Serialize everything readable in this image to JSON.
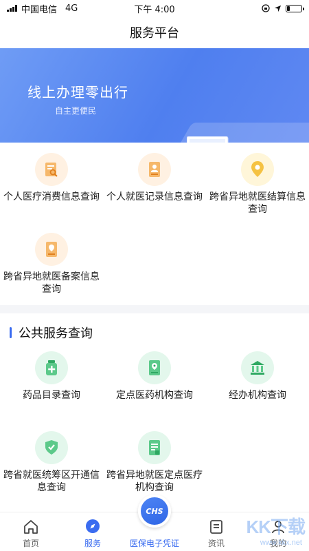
{
  "status_bar": {
    "carrier": "中国电信",
    "network": "4G",
    "time": "下午 4:00",
    "battery_level": 0.2
  },
  "nav": {
    "title": "服务平台"
  },
  "banner": {
    "title": "线上办理零出行",
    "subtitle": "自主更便民"
  },
  "services": [
    {
      "label": "个人医疗消费信息查询",
      "icon": "receipt-search-icon",
      "color": "#f39b3a"
    },
    {
      "label": "个人就医记录信息查询",
      "icon": "person-card-icon",
      "color": "#f39b3a"
    },
    {
      "label": "跨省异地就医结算信息查询",
      "icon": "location-pin-icon",
      "color": "#f4b400"
    },
    {
      "label": "跨省异地就医备案信息查询",
      "icon": "document-pin-icon",
      "color": "#f39b3a"
    }
  ],
  "public_section": {
    "title": "公共服务查询",
    "items": [
      {
        "label": "药品目录查询",
        "icon": "medicine-bottle-icon"
      },
      {
        "label": "定点医药机构查询",
        "icon": "map-location-icon"
      },
      {
        "label": "经办机构查询",
        "icon": "bank-building-icon"
      },
      {
        "label": "跨省就医统筹区开通信息查询",
        "icon": "shield-location-icon"
      },
      {
        "label": "跨省异地就医定点医疗机构查询",
        "icon": "document-list-icon"
      }
    ]
  },
  "tab_bar": {
    "tabs": [
      {
        "label": "首页",
        "icon": "home-icon"
      },
      {
        "label": "服务",
        "icon": "compass-icon",
        "active": true
      },
      {
        "label": "医保电子凭证",
        "icon": "chs-icon",
        "badge": "CHS"
      },
      {
        "label": "资讯",
        "icon": "news-icon"
      },
      {
        "label": "我的",
        "icon": "user-icon"
      }
    ]
  },
  "watermark": {
    "text": "KK下载",
    "url": "www.kkx.net"
  },
  "colors": {
    "accent": "#3a6cf0",
    "orange": "#f39b3a",
    "green": "#35b86f",
    "yellow": "#f4b400"
  }
}
